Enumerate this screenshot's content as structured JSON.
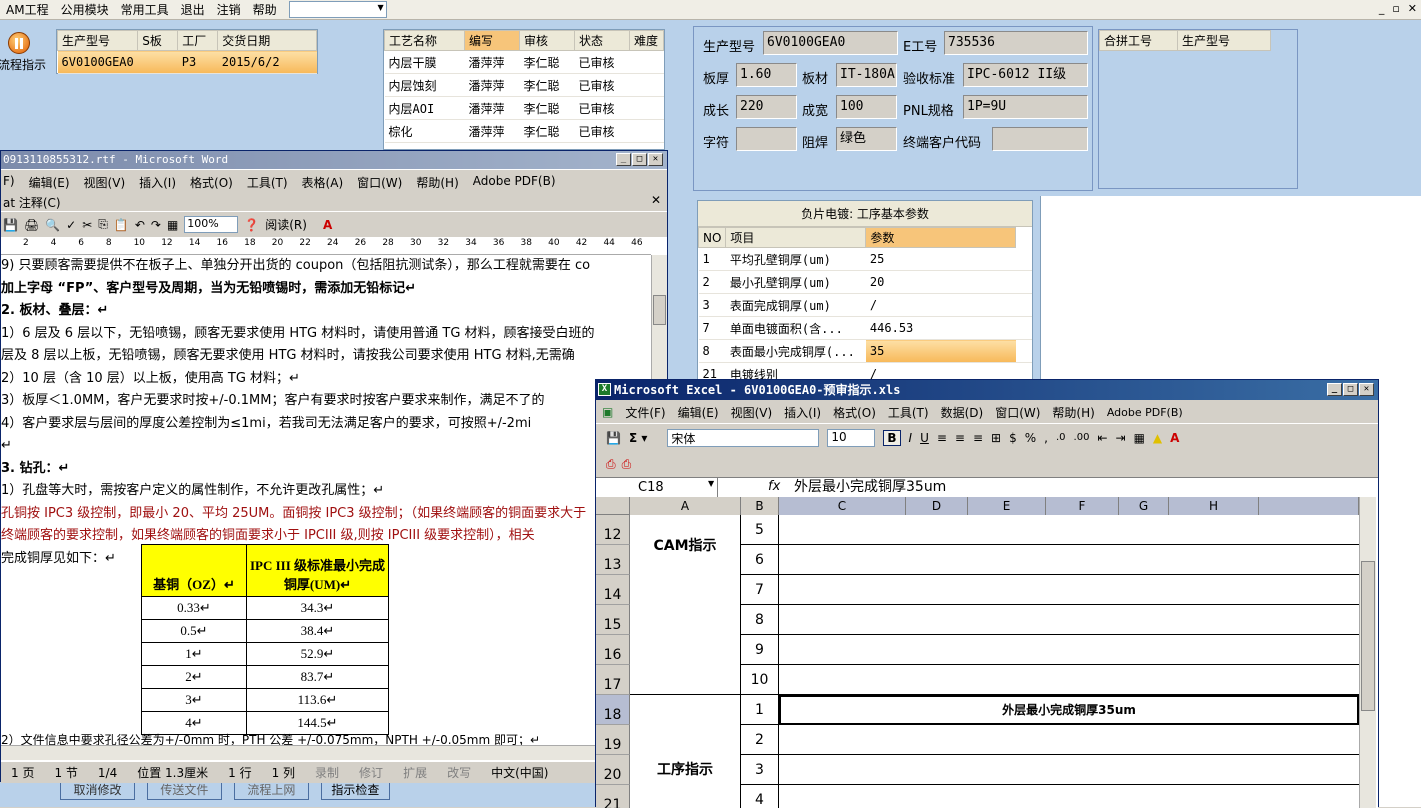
{
  "menubar": {
    "items": [
      "AM工程",
      "公用模块",
      "常用工具",
      "退出",
      "注销",
      "帮助"
    ]
  },
  "win_controls": [
    "_",
    "▫",
    "✕"
  ],
  "left": {
    "flow_button": "流程指示",
    "bottom_buttons": [
      "取消修改",
      "传送文件",
      "流程上网",
      "指示检查"
    ]
  },
  "order_grid": {
    "headers": [
      "生产型号",
      "S板",
      "工厂",
      "交货日期"
    ],
    "row": [
      "6V0100GEA0",
      "",
      "P3",
      "2015/6/2"
    ]
  },
  "process_grid": {
    "headers": [
      "工艺名称",
      "编写",
      "审核",
      "状态",
      "难度"
    ],
    "rows": [
      [
        "内层干膜",
        "潘萍萍",
        "李仁聪",
        "已审核",
        ""
      ],
      [
        "内层蚀刻",
        "潘萍萍",
        "李仁聪",
        "已审核",
        ""
      ],
      [
        "内层AOI",
        "潘萍萍",
        "李仁聪",
        "已审核",
        ""
      ],
      [
        "棕化",
        "潘萍萍",
        "李仁聪",
        "已审核",
        ""
      ]
    ]
  },
  "info": {
    "model_label": "生产型号",
    "model": "6V0100GEA0",
    "e_label": "E工号",
    "e_no": "735536",
    "thick_label": "板厚",
    "thick": "1.60",
    "mat_label": "板材",
    "mat": "IT-180A",
    "std_label": "验收标准",
    "std": "IPC-6012 II级",
    "len_label": "成长",
    "len": "220",
    "wid_label": "成宽",
    "wid": "100",
    "pnl_label": "PNL规格",
    "pnl": "1P=9U",
    "char_label": "字符",
    "char": "",
    "mask_label": "阻焊",
    "mask": "绿色",
    "cust_label": "终端客户代码",
    "cust": ""
  },
  "merge_grid": {
    "headers": [
      "合拼工号",
      "生产型号"
    ]
  },
  "param_panel": {
    "title": "负片电镀: 工序基本参数",
    "headers": [
      "NO",
      "项目",
      "参数"
    ],
    "rows": [
      [
        "1",
        "平均孔壁铜厚(um)",
        "25"
      ],
      [
        "2",
        "最小孔壁铜厚(um)",
        "20"
      ],
      [
        "3",
        "表面完成铜厚(um)",
        "/"
      ],
      [
        "7",
        "单面电镀面积(含...",
        "446.53"
      ],
      [
        "8",
        "表面最小完成铜厚(...",
        "35"
      ],
      [
        "21",
        "电镀线别",
        "/"
      ]
    ]
  },
  "word": {
    "title": "0913110855312.rtf - Microsoft Word",
    "menu": [
      "F)",
      "编辑(E)",
      "视图(V)",
      "插入(I)",
      "格式(O)",
      "工具(T)",
      "表格(A)",
      "窗口(W)",
      "帮助(H)",
      "Adobe PDF(B)"
    ],
    "menu2": "at 注释(C)",
    "zoom": "100%",
    "read": "阅读(R)",
    "ruler": [
      "2",
      "4",
      "6",
      "8",
      "10",
      "12",
      "14",
      "16",
      "18",
      "20",
      "22",
      "24",
      "26",
      "28",
      "30",
      "32",
      "34",
      "36",
      "38",
      "40",
      "42",
      "44",
      "46"
    ],
    "lines": [
      "   9) 只要顾客需要提供不在板子上、单独分开出货的 coupon（包括阻抗测试条），那么工程就需要在 co",
      "       加上字母 “FP”、客户型号及周期，当为无铅喷锡时，需添加无铅标记↵",
      "2.   板材、叠层：↵",
      "    1）6 层及 6 层以下，无铅喷锡，顾客无要求使用 HTG 材料时，请使用普通 TG 材料，顾客接受白班的",
      "       层及 8 层以上板，无铅喷锡，顾客无要求使用 HTG 材料时，请按我公司要求使用 HTG 材料,无需确",
      "    2）10 层（含 10 层）以上板，使用高 TG 材料；↵",
      "    3）板厚＜1.0MM，客户无要求时按+/-0.1MM；客户有要求时按客户要求来制作，满足不了的",
      "    4）客户要求层与层间的厚度公差控制为≤1mi，若我司无法满足客户的要求，可按照+/-2mi",
      "↵",
      "3.   钻孔：↵",
      "    1）孔盘等大时，需按客户定义的属性制作，不允许更改孔属性；↵",
      "孔铜按 IPC3 级控制，即最小 20、平均 25UM。面铜按 IPC3 级控制；（如果终端顾客的铜面要求大于",
      "终端顾客的要求控制，如果终端顾客的铜面要求小于 IPCIII 级,则按 IPCIII 级要求控制），相关",
      "完成铜厚见如下：↵"
    ],
    "table_headers": [
      "基铜（OZ）↵",
      "IPC III 级标准最小完成铜厚(UM)↵"
    ],
    "table_rows": [
      [
        "0.33↵",
        "34.3↵"
      ],
      [
        "0.5↵",
        "38.4↵"
      ],
      [
        "1↵",
        "52.9↵"
      ],
      [
        "2↵",
        "83.7↵"
      ],
      [
        "3↵",
        "113.6↵"
      ],
      [
        "4↵",
        "144.5↵"
      ]
    ],
    "last_line": "    2）文件信息中要求孔径公差为+/-0mm 时，PTH 公差 +/-0.075mm，NPTH +/-0.05mm 即可；↵",
    "status": [
      "1 页",
      "1 节",
      "1/4",
      "位置 1.3厘米",
      "1 行",
      "1 列",
      "录制",
      "修订",
      "扩展",
      "改写",
      "中文(中国)"
    ]
  },
  "excel": {
    "title": "Microsoft Excel - 6V0100GEA0-预审指示.xls",
    "menu": [
      "文件(F)",
      "编辑(E)",
      "视图(V)",
      "插入(I)",
      "格式(O)",
      "工具(T)",
      "数据(D)",
      "窗口(W)",
      "帮助(H)",
      "Adobe PDF(B)"
    ],
    "font": "宋体",
    "size": "10",
    "cellref": "C18",
    "formula": "外层最小完成铜厚35um",
    "cols": [
      "A",
      "B",
      "C",
      "D",
      "E",
      "F",
      "G",
      "H"
    ],
    "rows": [
      "12",
      "13",
      "14",
      "15",
      "16",
      "17",
      "18",
      "19",
      "20",
      "21"
    ],
    "b_vals": [
      "5",
      "6",
      "7",
      "8",
      "9",
      "10",
      "1",
      "2",
      "3",
      "4"
    ],
    "merge1": "CAM指示",
    "merge2": "工序指示",
    "c18": "外层最小完成铜厚35um"
  }
}
